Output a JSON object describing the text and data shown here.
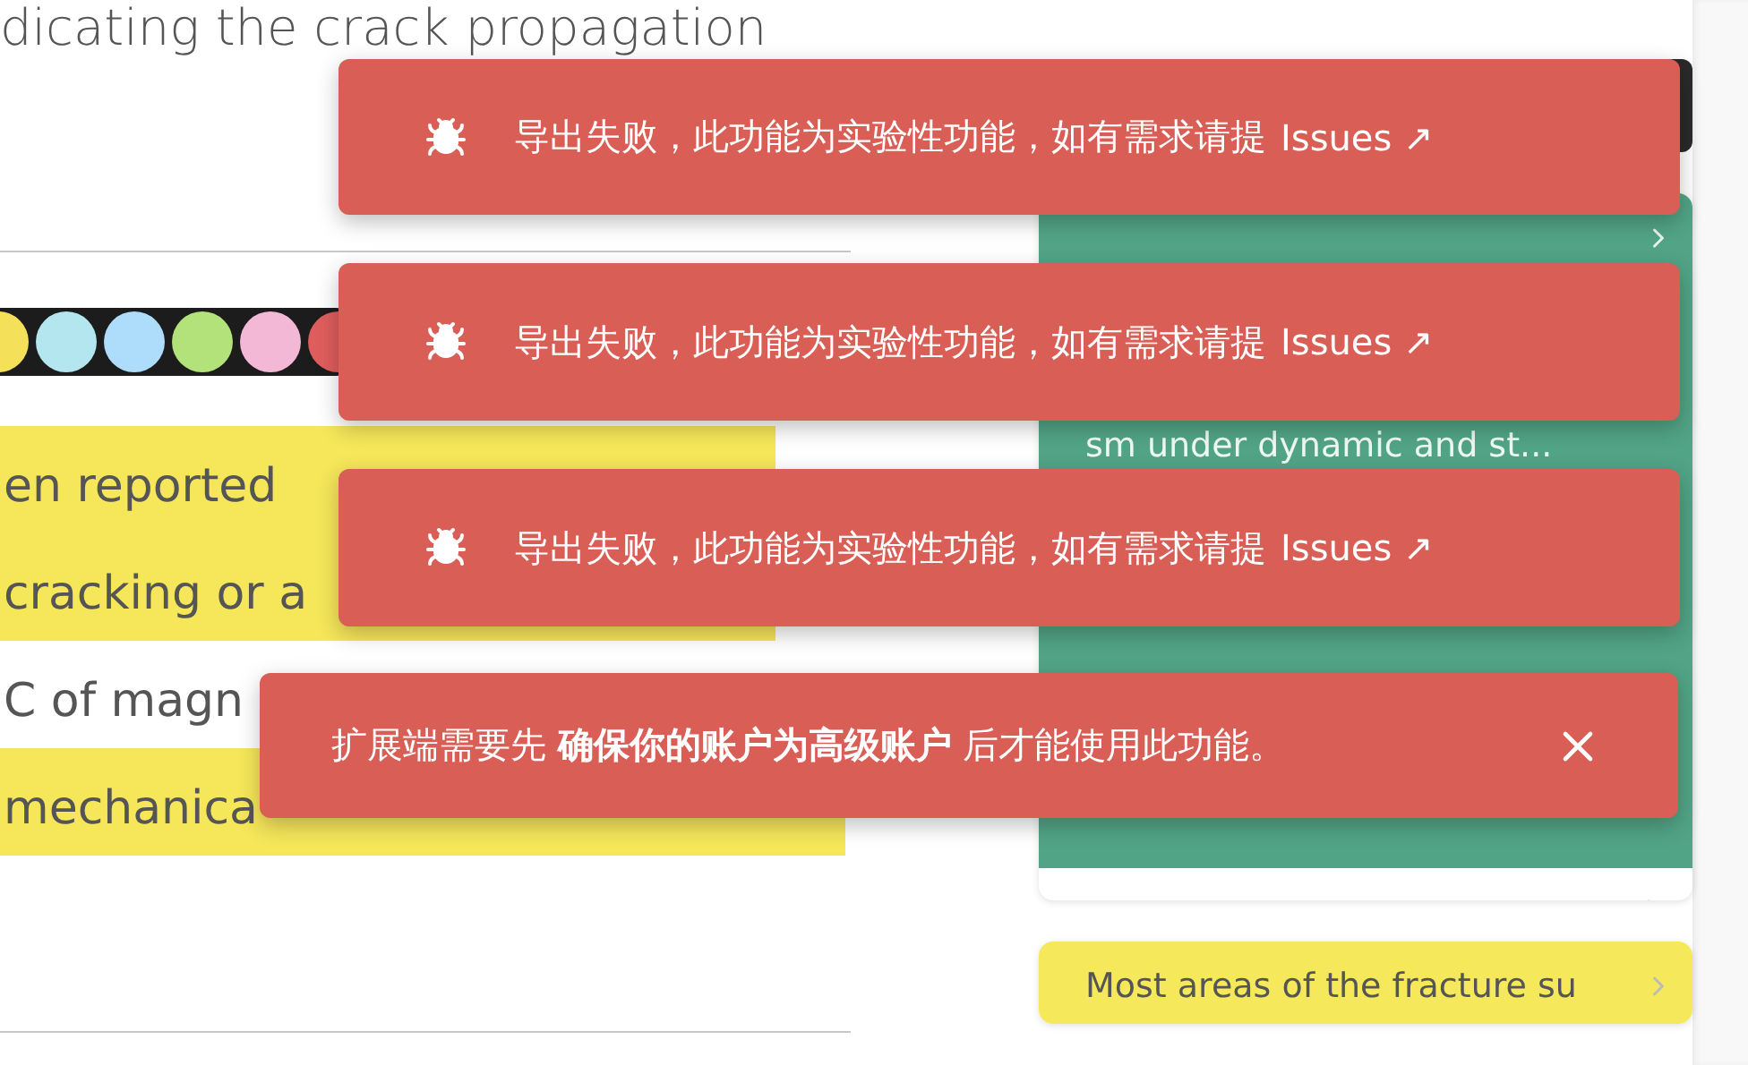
{
  "article": {
    "heading": "dicating the crack propagation",
    "palette": [
      {
        "color": "#f5e05a"
      },
      {
        "color": "#b3e6ef"
      },
      {
        "color": "#aedcfb"
      },
      {
        "color": "#b4e27a"
      },
      {
        "color": "#f3b8d6"
      },
      {
        "color": "#e05d5d"
      }
    ],
    "lines": [
      {
        "text": "en reported",
        "highlighted": true
      },
      {
        "text": "cracking or a",
        "highlighted": true
      },
      {
        "text": "C of magn",
        "highlighted": false
      },
      {
        "text": "mechanica",
        "highlighted": true
      }
    ]
  },
  "sidebar": {
    "cards": [
      {
        "kind": "with-footer",
        "color": "#52a486",
        "text": "sm under dynamic and st..."
      },
      {
        "kind": "plain",
        "color": "#f5e85a",
        "text": "Most areas of the fracture su"
      }
    ]
  },
  "toasts": [
    {
      "kind": "link",
      "message": "导出失败，此功能为实验性功能，如有需求请提",
      "link": "Issues ↗"
    },
    {
      "kind": "link",
      "message": "导出失败，此功能为实验性功能，如有需求请提",
      "link": "Issues ↗"
    },
    {
      "kind": "link",
      "message": "导出失败，此功能为实验性功能，如有需求请提",
      "link": "Issues ↗"
    },
    {
      "kind": "closable",
      "message": "扩展端需要先 **确保你的账户为高级账户** 后才能使用此功能。"
    }
  ]
}
